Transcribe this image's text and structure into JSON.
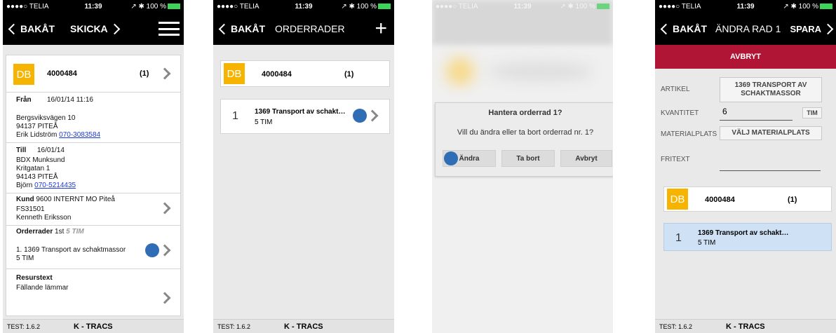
{
  "status": {
    "carrier": "●●●●○ TELIA",
    "time": "11:39",
    "right": "↗ ✱ 100 %"
  },
  "nav": {
    "back": "BAKÅT",
    "send": "SKICKA",
    "orderrader": "ORDERRADER",
    "edit_title": "ÄNDRA RAD 1",
    "save": "SPARA"
  },
  "order": {
    "tile": "DB",
    "number": "4000484",
    "count": "(1)"
  },
  "from": {
    "label": "Från",
    "datetime": "16/01/14 11:16",
    "street": "Bergsviksvägen 10",
    "city": "94137 PITEÅ",
    "contact": "Erik Lidström",
    "phone": "070-3083584"
  },
  "to": {
    "label": "Till",
    "date": "16/01/14",
    "name": "BDX Munksund",
    "street": "Kritgatan 1",
    "city": "94143 PITEÅ",
    "contact": "Björn",
    "phone": "070-5214435"
  },
  "customer": {
    "label": "Kund",
    "value": "9600 INTERNT MO Piteå",
    "code": "FS31501",
    "contact": "Kenneth Eriksson"
  },
  "orderrows": {
    "label": "Orderrader",
    "count": "1st",
    "qty": "5 TIM",
    "line": "1. 1369 Transport av schaktmassor",
    "line_qty": "5 TIM"
  },
  "resource": {
    "label": "Resurstext",
    "value": "Fällande lämmar"
  },
  "footer": {
    "version": "TEST: 1.6.2",
    "brand": "K - TRACS"
  },
  "row": {
    "num": "1",
    "title": "1369 Transport av schakt…",
    "qty": "5 TIM"
  },
  "dialog": {
    "title": "Hantera orderrad 1?",
    "message": "Vill du ändra eller ta bort orderrad nr. 1?",
    "edit": "Ändra",
    "delete": "Ta bort",
    "cancel": "Avbryt"
  },
  "edit": {
    "cancel": "AVBRYT",
    "article_label": "ARTIKEL",
    "article_value": "1369 TRANSPORT AV SCHAKTMASSOR",
    "qty_label": "KVANTITET",
    "qty_value": "6",
    "unit": "TIM",
    "material_label": "MATERIALPLATS",
    "material_button": "VÄLJ MATERIALPLATS",
    "freetext_label": "FRITEXT"
  },
  "colors": {
    "accent": "#f6b400",
    "cancel": "#b11536",
    "tap": "#2f6db5",
    "selected": "#cfe2f5"
  }
}
